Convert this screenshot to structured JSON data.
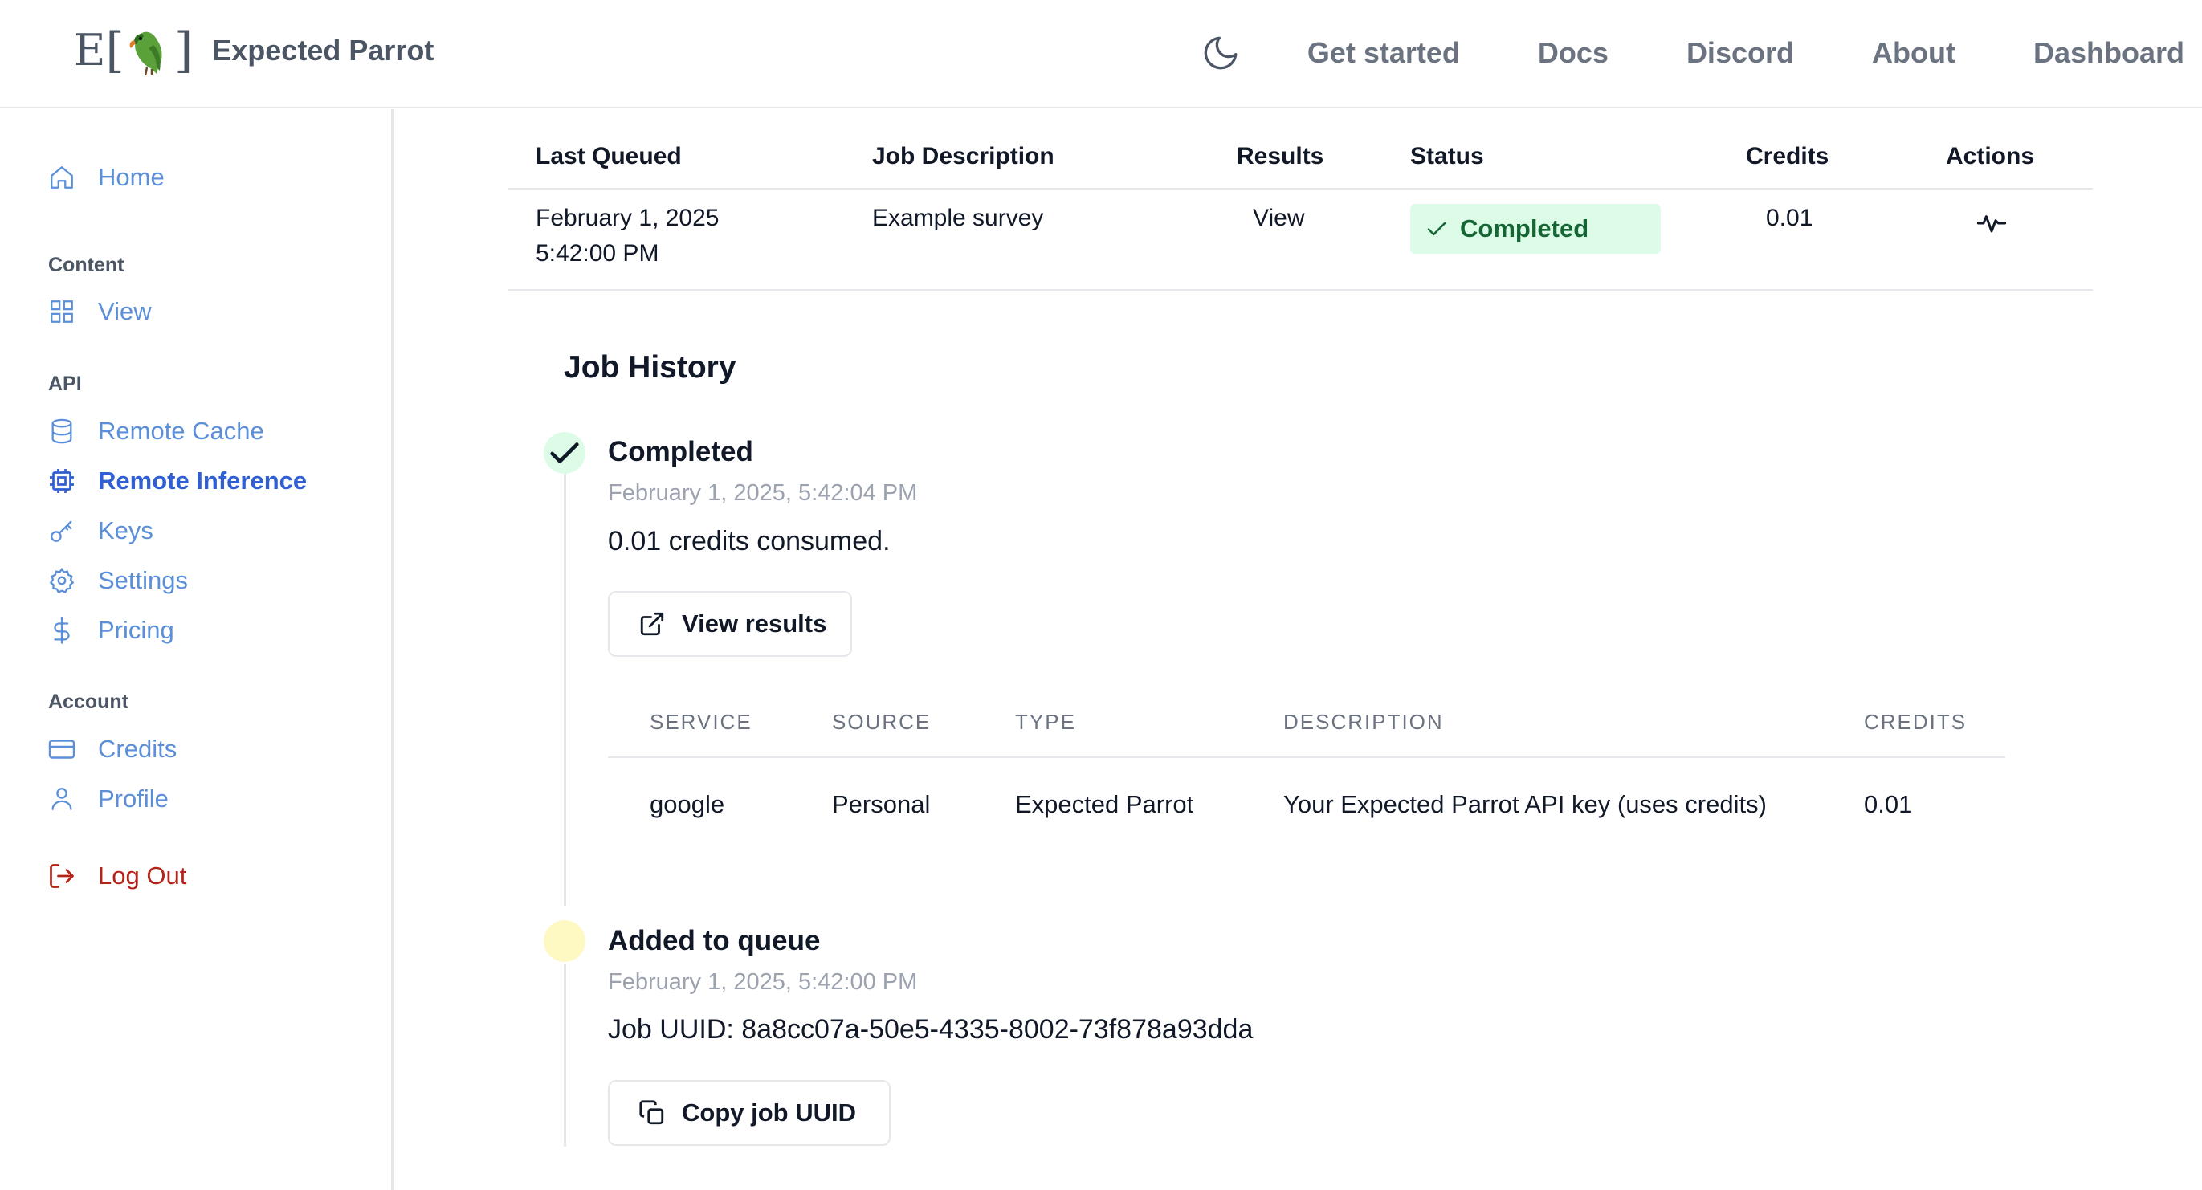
{
  "header": {
    "brand_name": "Expected Parrot",
    "logo_letter": "E",
    "nav": [
      "Get started",
      "Docs",
      "Discord",
      "About",
      "Dashboard"
    ]
  },
  "sidebar": {
    "home": "Home",
    "content_heading": "Content",
    "view": "View",
    "api_heading": "API",
    "remote_cache": "Remote Cache",
    "remote_inference": "Remote Inference",
    "keys": "Keys",
    "settings": "Settings",
    "pricing": "Pricing",
    "account_heading": "Account",
    "credits": "Credits",
    "profile": "Profile",
    "logout": "Log Out"
  },
  "jobs_table": {
    "columns": [
      "Last Queued",
      "Job Description",
      "Results",
      "Status",
      "Credits",
      "Actions"
    ],
    "row": {
      "date": "February 1, 2025",
      "time": "5:42:00 PM",
      "description": "Example survey",
      "results_link": "View",
      "status": "Completed",
      "credits": "0.01"
    }
  },
  "history": {
    "title": "Job History",
    "completed": {
      "title": "Completed",
      "time": "February 1, 2025, 5:42:04 PM",
      "text": "0.01 credits consumed.",
      "button": "View results",
      "table": {
        "columns": [
          "SERVICE",
          "SOURCE",
          "TYPE",
          "DESCRIPTION",
          "CREDITS"
        ],
        "row": [
          "google",
          "Personal",
          "Expected Parrot",
          "Your Expected Parrot API key (uses credits)",
          "0.01"
        ]
      }
    },
    "queued": {
      "title": "Added to queue",
      "time": "February 1, 2025, 5:42:00 PM",
      "text": "Job UUID: 8a8cc07a-50e5-4335-8002-73f878a93dda",
      "button": "Copy job UUID"
    }
  },
  "colors": {
    "link": "#5b8fd9",
    "active": "#2f5fd3",
    "logout": "#b42318",
    "status_bg": "#dcfce7",
    "status_text": "#166534",
    "queue_dot": "#fef9c3",
    "done_dot": "#dcfce7"
  }
}
